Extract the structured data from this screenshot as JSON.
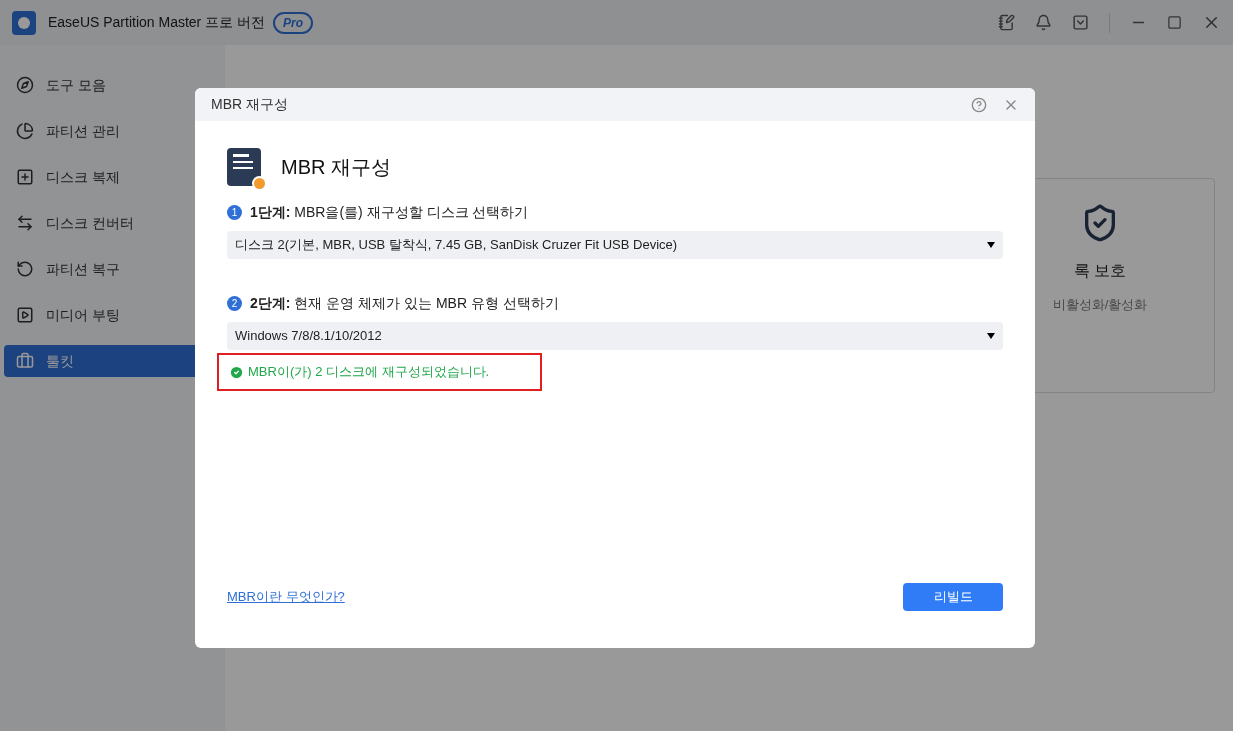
{
  "app": {
    "title": "EaseUS Partition Master 프로 버전",
    "badge": "Pro"
  },
  "sidebar": {
    "items": [
      {
        "label": "도구 모음",
        "selected": false
      },
      {
        "label": "파티션 관리",
        "selected": false
      },
      {
        "label": "디스크 복제",
        "selected": false
      },
      {
        "label": "디스크 컨버터",
        "selected": false
      },
      {
        "label": "파티션 복구",
        "selected": false
      },
      {
        "label": "미디어 부팅",
        "selected": false
      },
      {
        "label": "툴킷",
        "selected": true
      }
    ]
  },
  "background_card": {
    "title": "록 보호",
    "subtitle": "비활성화/활성화"
  },
  "dialog": {
    "title": "MBR 재구성",
    "heading": "MBR 재구성",
    "steps": [
      {
        "number": "1",
        "label": "**1단계:** MBR을(를) 재구성할 디스크 선택하기",
        "value": "디스크 2(기본, MBR, USB 탈착식, 7.45 GB, SanDisk Cruzer Fit USB Device)"
      },
      {
        "number": "2",
        "label": "**2단계:** 현재 운영 체제가 있는 MBR 유형 선택하기",
        "value": "Windows 7/8/8.1/10/2012"
      }
    ],
    "message": {
      "text": "MBR이(가) 2 디스크에 재구성되었습니다.",
      "highlighted": true
    },
    "help_link": "MBR이란 무엇인가?",
    "button": "리빌드"
  }
}
